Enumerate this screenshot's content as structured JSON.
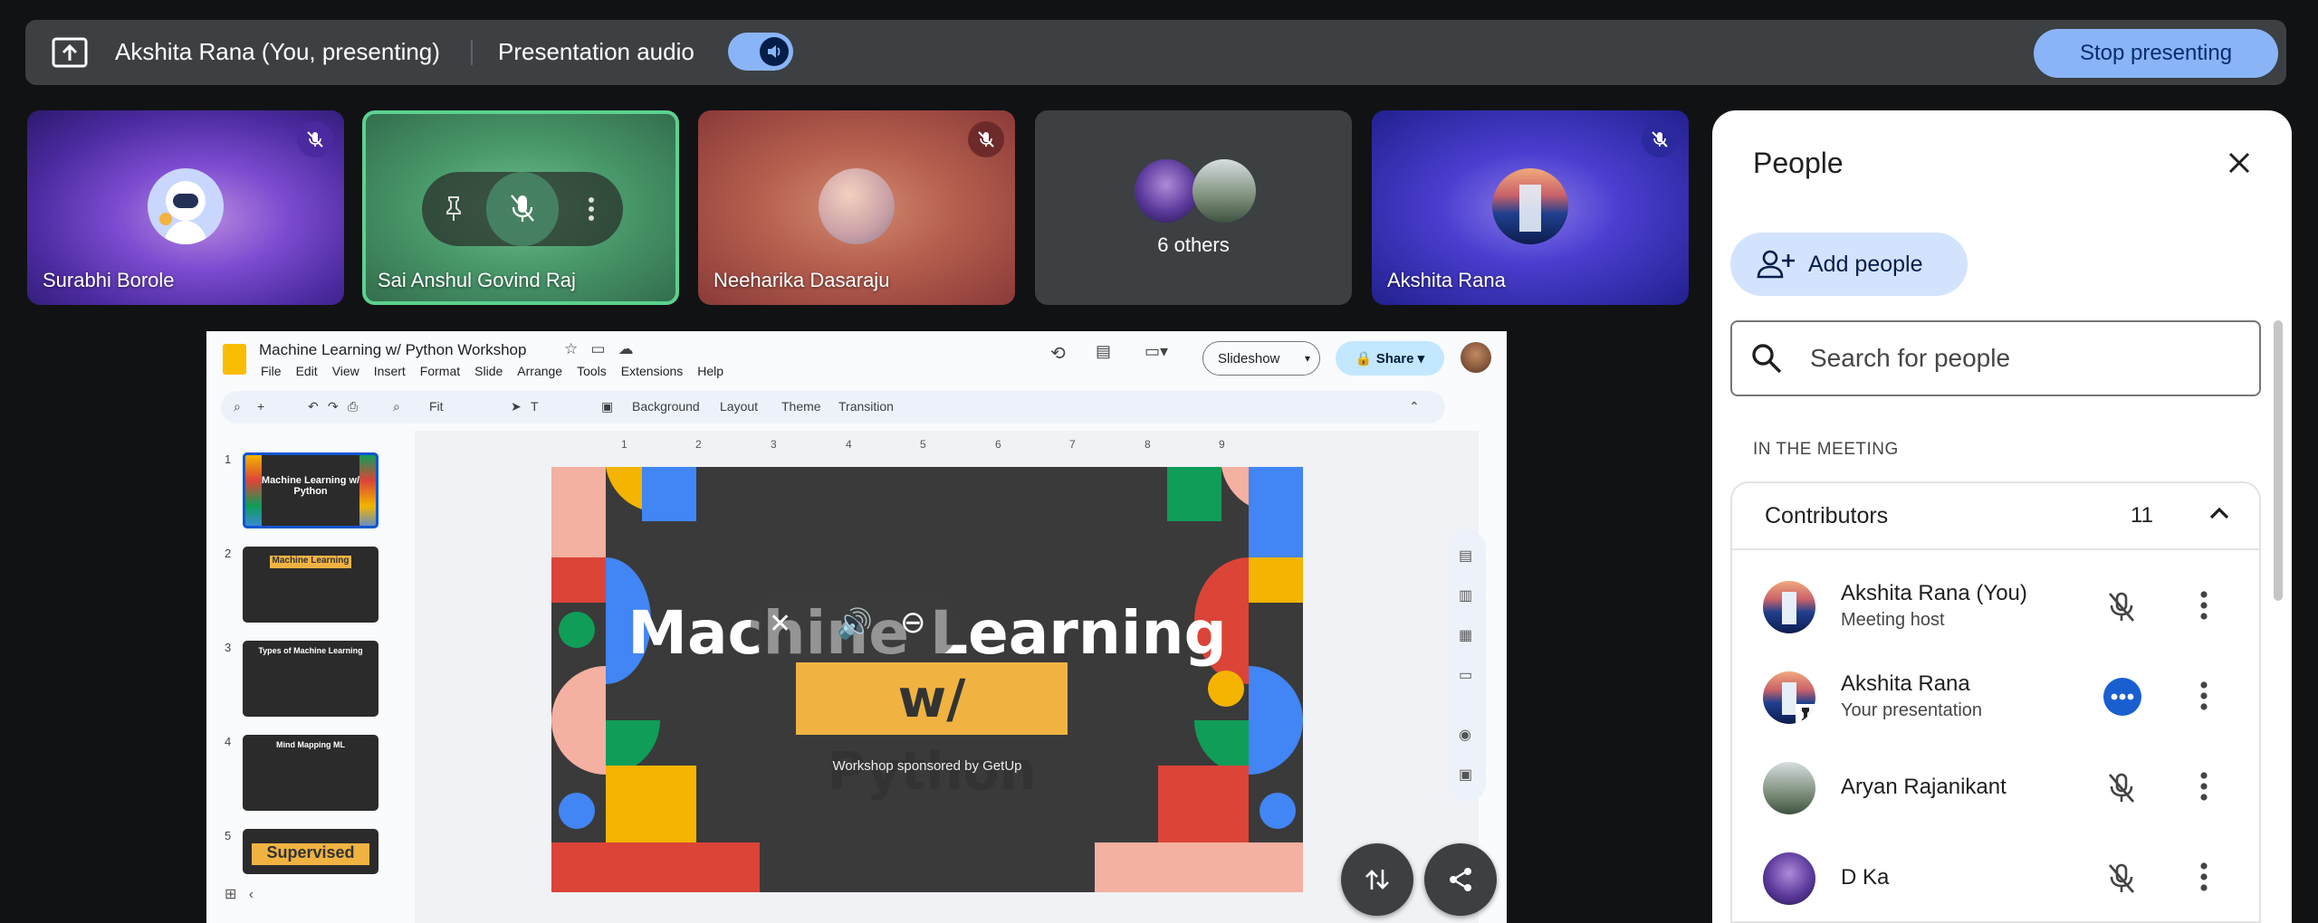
{
  "topbar": {
    "presenter": "Akshita Rana (You, presenting)",
    "audio_label": "Presentation audio",
    "stop_label": "Stop presenting"
  },
  "tiles": [
    {
      "name": "Surabhi Borole",
      "muted": true
    },
    {
      "name": "Sai Anshul Govind Raj",
      "muted": false,
      "active": true
    },
    {
      "name": "Neeharika Dasaraju",
      "muted": true
    },
    {
      "name": "6 others"
    },
    {
      "name": "Akshita Rana",
      "muted": true
    }
  ],
  "slides_app": {
    "doc_title": "Machine Learning  w/ Python Workshop",
    "menu": [
      "File",
      "Edit",
      "View",
      "Insert",
      "Format",
      "Slide",
      "Arrange",
      "Tools",
      "Extensions",
      "Help"
    ],
    "slideshow_label": "Slideshow",
    "share_label": "Share",
    "zoom": "Fit",
    "toolbar_items": [
      "Background",
      "Layout",
      "Theme",
      "Transition"
    ],
    "slide_numbers": [
      "1",
      "2",
      "3",
      "4",
      "5"
    ],
    "thumb_titles": [
      "Machine Learning w/ Python",
      "Machine Learning",
      "Types of Machine Learning",
      "Mind Mapping ML",
      "Supervised"
    ],
    "ruler_numbers": [
      "1",
      "2",
      "3",
      "4",
      "5",
      "6",
      "7",
      "8",
      "9"
    ],
    "slide": {
      "title_line1": "Machine Learning",
      "title_line2": "w/ Python",
      "subtitle": "Workshop sponsored by GetUp"
    }
  },
  "people": {
    "title": "People",
    "add_label": "Add people",
    "search_placeholder": "Search for people",
    "section": "IN THE MEETING",
    "contributors_label": "Contributors",
    "contributors_count": "11",
    "list": [
      {
        "name": "Akshita Rana (You)",
        "sub": "Meeting host",
        "status": "muted"
      },
      {
        "name": "Akshita Rana",
        "sub": "Your presentation",
        "status": "presenting"
      },
      {
        "name": "Aryan Rajanikant",
        "sub": "",
        "status": "muted"
      },
      {
        "name": "D Ka",
        "sub": "",
        "status": "muted"
      }
    ]
  },
  "colors": {
    "accent": "#8ab4f8",
    "active_border": "#5bd28f",
    "bg": "#111214"
  }
}
